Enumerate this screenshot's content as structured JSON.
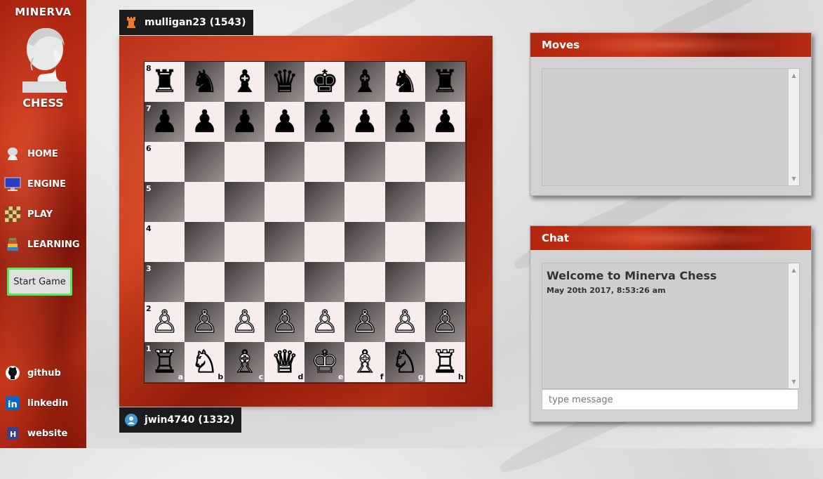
{
  "sidebar": {
    "brand_top": "MINERVA",
    "brand_bottom": "CHESS",
    "nav": [
      {
        "label": "HOME",
        "icon": "bust-icon"
      },
      {
        "label": "ENGINE",
        "icon": "monitor-icon"
      },
      {
        "label": "PLAY",
        "icon": "chessboard-icon"
      },
      {
        "label": "LEARNING",
        "icon": "books-icon"
      }
    ],
    "start_button": "Start Game",
    "social": [
      {
        "label": "github",
        "icon": "github-icon"
      },
      {
        "label": "linkedin",
        "icon": "linkedin-icon"
      },
      {
        "label": "website",
        "icon": "website-icon"
      }
    ]
  },
  "players": {
    "top": {
      "name": "mulligan23 (1543)",
      "icon": "rook-icon"
    },
    "bottom": {
      "name": "jwin4740 (1332)",
      "icon": "user-icon"
    }
  },
  "board": {
    "ranks": [
      "8",
      "7",
      "6",
      "5",
      "4",
      "3",
      "2",
      "1"
    ],
    "files": [
      "a",
      "b",
      "c",
      "d",
      "e",
      "f",
      "g",
      "h"
    ],
    "position": [
      [
        "♜",
        "♞",
        "♝",
        "♛",
        "♚",
        "♝",
        "♞",
        "♜"
      ],
      [
        "♟",
        "♟",
        "♟",
        "♟",
        "♟",
        "♟",
        "♟",
        "♟"
      ],
      [
        "",
        "",
        "",
        "",
        "",
        "",
        "",
        ""
      ],
      [
        "",
        "",
        "",
        "",
        "",
        "",
        "",
        ""
      ],
      [
        "",
        "",
        "",
        "",
        "",
        "",
        "",
        ""
      ],
      [
        "",
        "",
        "",
        "",
        "",
        "",
        "",
        ""
      ],
      [
        "♙",
        "♙",
        "♙",
        "♙",
        "♙",
        "♙",
        "♙",
        "♙"
      ],
      [
        "♖",
        "♘",
        "♗",
        "♕",
        "♔",
        "♗",
        "♘",
        "♖"
      ]
    ]
  },
  "moves_panel": {
    "title": "Moves"
  },
  "chat_panel": {
    "title": "Chat",
    "messages": [
      {
        "text": "Welcome to Minerva Chess",
        "time": "May 20th 2017, 8:53:26 am"
      }
    ],
    "input_placeholder": "type message"
  },
  "colors": {
    "accent_red": "#c53217",
    "start_border": "#53e85f"
  }
}
